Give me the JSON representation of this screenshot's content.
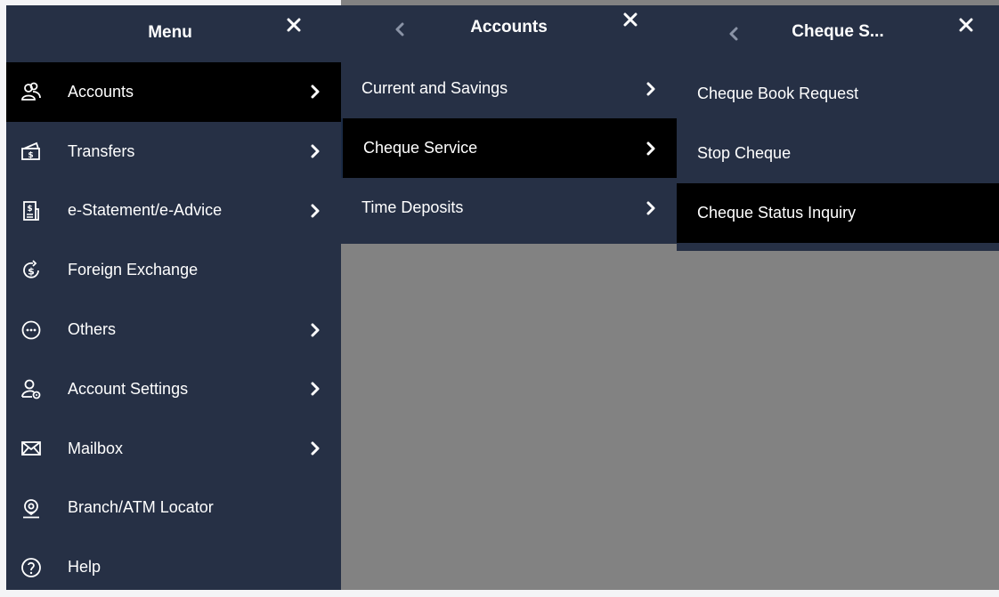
{
  "menu_panel": {
    "title": "Menu",
    "items": [
      {
        "label": "Accounts",
        "icon": "user-group-icon",
        "has_submenu": true,
        "active": true
      },
      {
        "label": "Transfers",
        "icon": "money-transfer-icon",
        "has_submenu": true,
        "active": false
      },
      {
        "label": "e-Statement/e-Advice",
        "icon": "statement-document-icon",
        "has_submenu": true,
        "active": false
      },
      {
        "label": "Foreign Exchange",
        "icon": "currency-exchange-icon",
        "has_submenu": false,
        "active": false
      },
      {
        "label": "Others",
        "icon": "more-dots-icon",
        "has_submenu": true,
        "active": false
      },
      {
        "label": "Account Settings",
        "icon": "user-settings-icon",
        "has_submenu": true,
        "active": false
      },
      {
        "label": "Mailbox",
        "icon": "envelope-icon",
        "has_submenu": true,
        "active": false
      },
      {
        "label": "Branch/ATM Locator",
        "icon": "location-pin-icon",
        "has_submenu": false,
        "active": false
      },
      {
        "label": "Help",
        "icon": "help-question-icon",
        "has_submenu": false,
        "active": false
      }
    ]
  },
  "accounts_panel": {
    "title": "Accounts",
    "items": [
      {
        "label": "Current and Savings",
        "has_submenu": true,
        "active": false
      },
      {
        "label": "Cheque Service",
        "has_submenu": true,
        "active": true
      },
      {
        "label": "Time Deposits",
        "has_submenu": true,
        "active": false
      }
    ]
  },
  "cheque_panel": {
    "title": "Cheque S...",
    "items": [
      {
        "label": "Cheque Book Request",
        "active": false
      },
      {
        "label": "Stop Cheque",
        "active": false
      },
      {
        "label": "Cheque Status Inquiry",
        "active": true
      }
    ]
  },
  "colors": {
    "panel_bg": "#263045",
    "active_bg": "#000000",
    "overlay_gray": "#828282",
    "text": "#ffffff"
  }
}
